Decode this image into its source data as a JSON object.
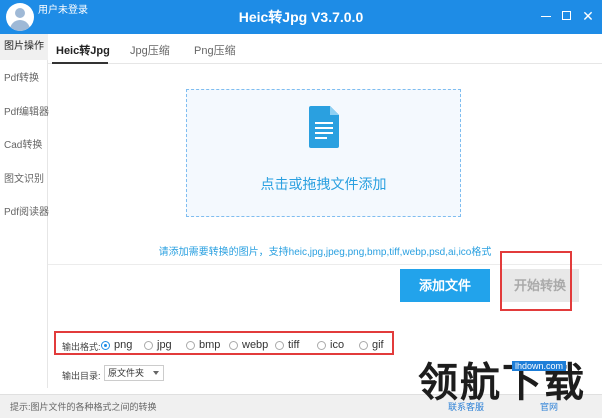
{
  "titlebar": {
    "user_label": "用户未登录",
    "app_title": "Heic转Jpg V3.7.0.0",
    "minimize": "",
    "maximize": "",
    "close": "✕"
  },
  "sidebar": {
    "items": [
      {
        "label": "图片操作",
        "active": true
      },
      {
        "label": "Pdf转换"
      },
      {
        "label": "Pdf编辑器"
      },
      {
        "label": "Cad转换"
      },
      {
        "label": "图文识别"
      },
      {
        "label": "Pdf阅读器"
      }
    ]
  },
  "tabs": [
    {
      "label": "Heic转Jpg",
      "active": true
    },
    {
      "label": "Jpg压缩"
    },
    {
      "label": "Png压缩"
    }
  ],
  "dropzone": {
    "icon": "document-icon",
    "text": "点击或拖拽文件添加"
  },
  "hint": "请添加需要转换的图片，支持heic,jpg,jpeg,png,bmp,tiff,webp,psd,ai,ico格式",
  "buttons": {
    "add_file": "添加文件",
    "start": "开始转换"
  },
  "output_format": {
    "label": "输出格式:",
    "options": [
      "png",
      "jpg",
      "bmp",
      "webp",
      "tiff",
      "ico",
      "gif"
    ],
    "selected": "png"
  },
  "output_dir": {
    "label": "输出目录:",
    "value": "原文件夹"
  },
  "statusbar": {
    "text": "提示:图片文件的各种格式之间的转换",
    "link1": "联系客服",
    "link2": "官网"
  },
  "watermark": {
    "text": "领航下载",
    "url": "lhdown.com"
  },
  "colors": {
    "accent": "#1E8CE6",
    "button": "#22a3eb",
    "highlight_box": "#e23b3b"
  }
}
